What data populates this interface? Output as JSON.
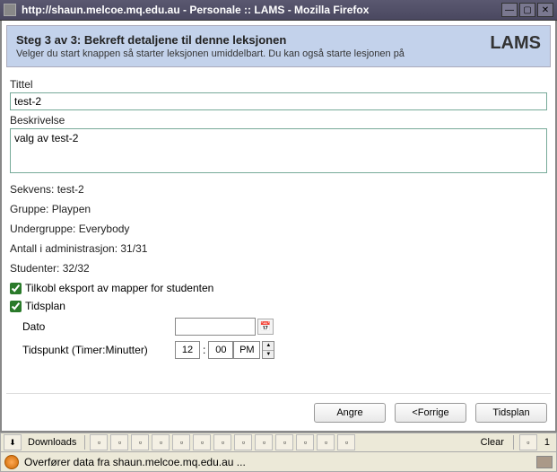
{
  "window": {
    "title": "http://shaun.melcoe.mq.edu.au - Personale :: LAMS - Mozilla Firefox"
  },
  "header": {
    "title": "Steg 3 av 3: Bekreft detaljene til denne leksjonen",
    "sub": "Velger du start knappen så starter leksjonen umiddelbart. Du kan også starte lesjonen på",
    "logo": "LAMS"
  },
  "fields": {
    "title_label": "Tittel",
    "title_value": "test-2",
    "desc_label": "Beskrivelse",
    "desc_value": "valg av test-2"
  },
  "info": {
    "sequence": "Sekvens: test-2",
    "group": "Gruppe: Playpen",
    "subgroup": "Undergruppe: Everybody",
    "admin_count": "Antall i administrasjon: 31/31",
    "students": "Studenter: 32/32"
  },
  "checks": {
    "export": "Tilkobl eksport av mapper for studenten",
    "schedule": "Tidsplan"
  },
  "schedule": {
    "date_label": "Dato",
    "date_value": "",
    "time_label": "Tidspunkt (Timer:Minutter)",
    "hour": "12",
    "minute": "00",
    "ampm": "PM"
  },
  "buttons": {
    "undo": "Angre",
    "prev": "<Forrige",
    "schedule": "Tidsplan"
  },
  "toolbar": {
    "downloads": "Downloads",
    "clear": "Clear",
    "count": "1"
  },
  "status": {
    "text": "Overfører data fra shaun.melcoe.mq.edu.au ..."
  }
}
